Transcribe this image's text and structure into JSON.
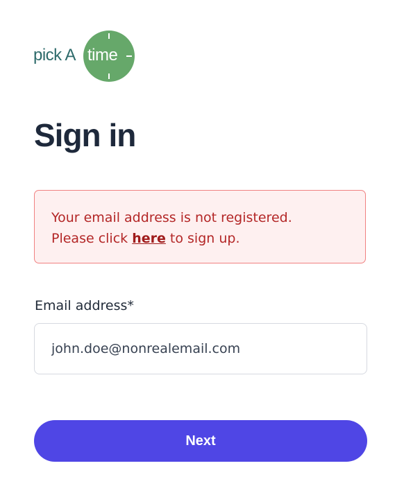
{
  "logo": {
    "text_left": "pick A",
    "text_circle": "time",
    "brand_color": "#66a86a",
    "text_color": "#2e6b6b"
  },
  "page_title": "Sign in",
  "alert": {
    "line1": "Your email address is not registered.",
    "line2_prefix": "Please click",
    "link_text": "here",
    "line2_suffix": "to sign up."
  },
  "form": {
    "email_label": "Email address*",
    "email_value": "john.doe@nonrealemail.com"
  },
  "actions": {
    "next_label": "Next",
    "primary_color": "#4f46e5"
  }
}
